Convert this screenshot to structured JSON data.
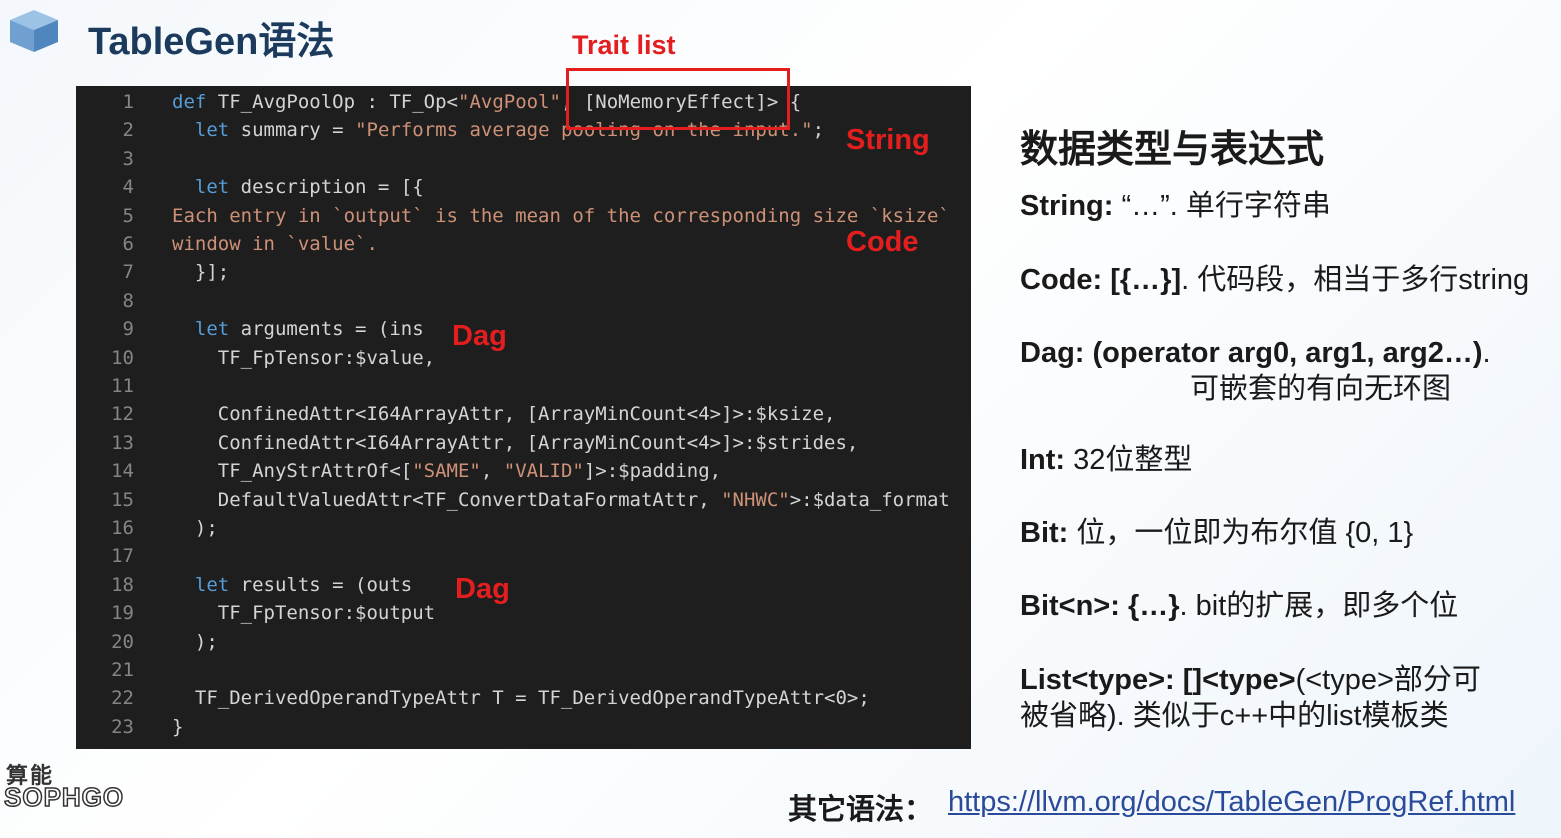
{
  "header": {
    "title": "TableGen语法",
    "trait_label": "Trait list"
  },
  "code": {
    "lines": [
      {
        "n": "1",
        "segs": [
          {
            "t": "def",
            "c": "kw"
          },
          {
            "t": " TF_AvgPoolOp : TF_Op<"
          },
          {
            "t": "\"AvgPool\"",
            "c": "st"
          },
          {
            "t": ", [NoMemoryEffect]> {"
          }
        ]
      },
      {
        "n": "2",
        "segs": [
          {
            "t": "  "
          },
          {
            "t": "let",
            "c": "kw"
          },
          {
            "t": " summary = "
          },
          {
            "t": "\"Performs average pooling on the input.\"",
            "c": "st"
          },
          {
            "t": ";"
          }
        ]
      },
      {
        "n": "3",
        "segs": []
      },
      {
        "n": "4",
        "segs": [
          {
            "t": "  "
          },
          {
            "t": "let",
            "c": "kw"
          },
          {
            "t": " description = [{"
          }
        ]
      },
      {
        "n": "5",
        "segs": [
          {
            "t": "Each entry in `output` is the mean of the corresponding size `ksize`",
            "c": "st"
          }
        ]
      },
      {
        "n": "6",
        "segs": [
          {
            "t": "window in `value`.",
            "c": "st"
          }
        ]
      },
      {
        "n": "7",
        "segs": [
          {
            "t": "  }];"
          }
        ]
      },
      {
        "n": "8",
        "segs": []
      },
      {
        "n": "9",
        "segs": [
          {
            "t": "  "
          },
          {
            "t": "let",
            "c": "kw"
          },
          {
            "t": " arguments = (ins"
          }
        ]
      },
      {
        "n": "10",
        "segs": [
          {
            "t": "    TF_FpTensor:$value,"
          }
        ]
      },
      {
        "n": "11",
        "segs": []
      },
      {
        "n": "12",
        "segs": [
          {
            "t": "    ConfinedAttr<I64ArrayAttr, [ArrayMinCount<4>]>:$ksize,"
          }
        ]
      },
      {
        "n": "13",
        "segs": [
          {
            "t": "    ConfinedAttr<I64ArrayAttr, [ArrayMinCount<4>]>:$strides,"
          }
        ]
      },
      {
        "n": "14",
        "segs": [
          {
            "t": "    TF_AnyStrAttrOf<["
          },
          {
            "t": "\"SAME\"",
            "c": "st"
          },
          {
            "t": ", "
          },
          {
            "t": "\"VALID\"",
            "c": "st"
          },
          {
            "t": "]>:$padding,"
          }
        ]
      },
      {
        "n": "15",
        "segs": [
          {
            "t": "    DefaultValuedAttr<TF_ConvertDataFormatAttr, "
          },
          {
            "t": "\"NHWC\"",
            "c": "st"
          },
          {
            "t": ">:$data_format"
          }
        ]
      },
      {
        "n": "16",
        "segs": [
          {
            "t": "  );"
          }
        ]
      },
      {
        "n": "17",
        "segs": []
      },
      {
        "n": "18",
        "segs": [
          {
            "t": "  "
          },
          {
            "t": "let",
            "c": "kw"
          },
          {
            "t": " results = (outs"
          }
        ]
      },
      {
        "n": "19",
        "segs": [
          {
            "t": "    TF_FpTensor:$output"
          }
        ]
      },
      {
        "n": "20",
        "segs": [
          {
            "t": "  );"
          }
        ]
      },
      {
        "n": "21",
        "segs": []
      },
      {
        "n": "22",
        "segs": [
          {
            "t": "  TF_DerivedOperandTypeAttr T = TF_DerivedOperandTypeAttr<0>;"
          }
        ]
      },
      {
        "n": "23",
        "segs": [
          {
            "t": "}"
          }
        ]
      }
    ]
  },
  "annotations": {
    "string": "String",
    "code": "Code",
    "dag1": "Dag",
    "dag2": "Dag"
  },
  "right": {
    "heading": "数据类型与表达式",
    "items": [
      {
        "label": "String:",
        "text": " “…”. 单行字符串"
      },
      {
        "label": "Code: [{…}]",
        "text": ". 代码段，相当于多行string"
      },
      {
        "label": "Dag: (operator arg0, arg1, arg2…)",
        "text": ".",
        "line2": "可嵌套的有向无环图"
      },
      {
        "label": "Int:",
        "text": " 32位整型"
      },
      {
        "label": "Bit:",
        "text": " 位，一位即为布尔值 {0, 1}"
      },
      {
        "label": "Bit<n>: {…}",
        "text": ". bit的扩展，即多个位"
      },
      {
        "label": "List<type>: []<type>",
        "text": "(<type>部分可",
        "line2": "被省略). 类似于c++中的list模板类"
      }
    ]
  },
  "footer": {
    "label": "其它语法：",
    "link": "https://llvm.org/docs/TableGen/ProgRef.html"
  },
  "brand": {
    "cn": "算能",
    "en": "SOPHGO"
  }
}
